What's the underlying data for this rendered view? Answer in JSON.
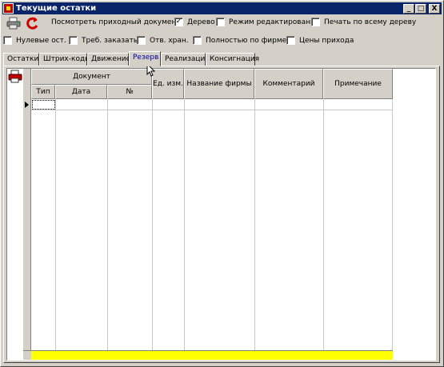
{
  "window": {
    "title": "Текущие остатки",
    "minimize": "_",
    "maximize": "□",
    "close": "X"
  },
  "toolbar": {
    "print_icon": "printer-icon",
    "refresh_icon": "refresh-icon",
    "view_doc_label": "Посмотреть приходный документ"
  },
  "options_row1": [
    {
      "label": "Дерево",
      "checked": true
    },
    {
      "label": "Режим редактирования",
      "checked": false
    },
    {
      "label": "Печать по всему дереву",
      "checked": false
    }
  ],
  "options_row2": [
    {
      "label": "Нулевые ост.",
      "checked": false
    },
    {
      "label": "Треб. заказать",
      "checked": false
    },
    {
      "label": "Отв. хран.",
      "checked": false
    },
    {
      "label": "Полностью по фирме",
      "checked": false
    },
    {
      "label": "Цены прихода",
      "checked": false
    }
  ],
  "tabs": [
    "Остатки",
    "Штрих-коды",
    "Движение",
    "Резерв",
    "Реализация",
    "Консигнация"
  ],
  "active_tab": "Резерв",
  "grid": {
    "group_header": "Документ",
    "columns": [
      "Тип",
      "Дата",
      "№",
      "Ед. изм.",
      "Название фирмы",
      "Комментарий",
      "Примечание"
    ]
  },
  "colors": {
    "footer": "#ffff00",
    "titlebar": "#0a246a",
    "active_tab_text": "#0000a0"
  }
}
